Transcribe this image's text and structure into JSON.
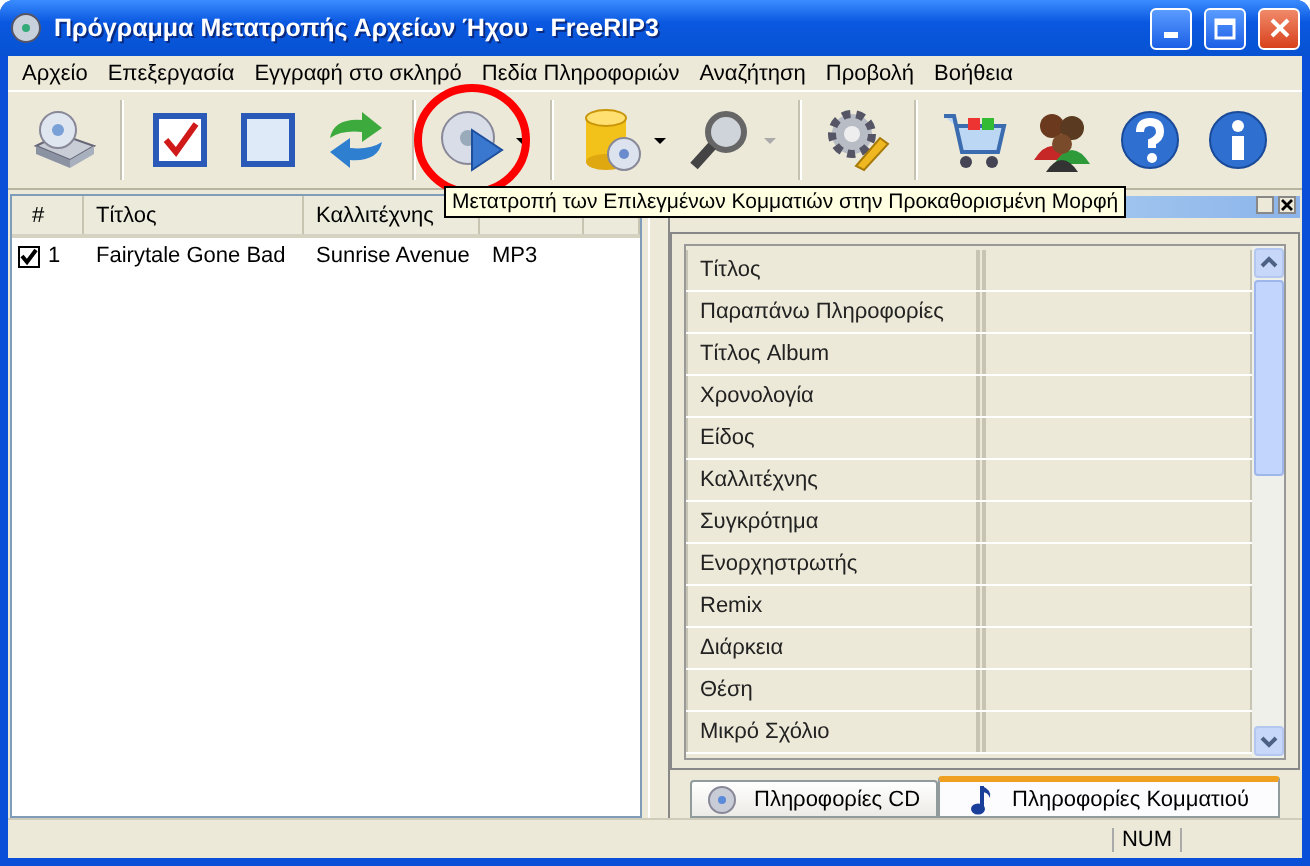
{
  "window": {
    "title": "Πρόγραμμα Μετατροπής Αρχείων Ήχου - FreeRIP3"
  },
  "menu": [
    "Αρχείο",
    "Επεξεργασία",
    "Εγγραφή στο σκληρό",
    "Πεδία Πληροφοριών",
    "Αναζήτηση",
    "Προβολή",
    "Βοήθεια"
  ],
  "toolbar": [
    {
      "buttons": [
        {
          "kind": "drive",
          "dropdown": false,
          "highlighted": false
        }
      ]
    },
    {
      "buttons": [
        {
          "kind": "check",
          "dropdown": false,
          "highlighted": false
        },
        {
          "kind": "uncheck",
          "dropdown": false,
          "highlighted": false
        },
        {
          "kind": "refresh",
          "dropdown": false,
          "highlighted": false
        }
      ]
    },
    {
      "buttons": [
        {
          "kind": "convert",
          "dropdown": true,
          "dropdown_disabled": false,
          "highlighted": true
        }
      ]
    },
    {
      "buttons": [
        {
          "kind": "database",
          "dropdown": true,
          "dropdown_disabled": false,
          "highlighted": false
        },
        {
          "kind": "search",
          "dropdown": true,
          "dropdown_disabled": true,
          "highlighted": false
        }
      ]
    },
    {
      "buttons": [
        {
          "kind": "settings",
          "dropdown": false,
          "highlighted": false
        }
      ]
    },
    {
      "buttons": [
        {
          "kind": "cart",
          "dropdown": false,
          "highlighted": false
        },
        {
          "kind": "people",
          "dropdown": false,
          "highlighted": false
        },
        {
          "kind": "help",
          "dropdown": false,
          "highlighted": false
        },
        {
          "kind": "info",
          "dropdown": false,
          "highlighted": false
        }
      ]
    }
  ],
  "tooltip": "Μετατροπή των Επιλεγμένων Κομματιών στην Προκαθορισμένη Μορφή",
  "tracks": {
    "columns": [
      "#",
      "Τίτλος",
      "Καλλιτέχνης"
    ],
    "rows": [
      {
        "checked": true,
        "number": "1",
        "title": "Fairytale Gone Bad",
        "artist": "Sunrise Avenue",
        "format": "MP3"
      }
    ]
  },
  "tag_panel": {
    "fields": [
      "Τίτλος",
      "Παραπάνω Πληροφορίες",
      "Τίτλος Album",
      "Χρονολογία",
      "Είδος",
      "Καλλιτέχνης",
      "Συγκρότημα",
      "Ενορχηστρωτής",
      "Remix",
      "Διάρκεια",
      "Θέση",
      "Μικρό Σχόλιο"
    ]
  },
  "tabs": [
    {
      "label": "Πληροφορίες CD",
      "selected": false,
      "kind": "cd"
    },
    {
      "label": "Πληροφορίες Κομματιού",
      "selected": true,
      "kind": "note"
    }
  ],
  "status_bar": {
    "indicator": "NUM"
  }
}
